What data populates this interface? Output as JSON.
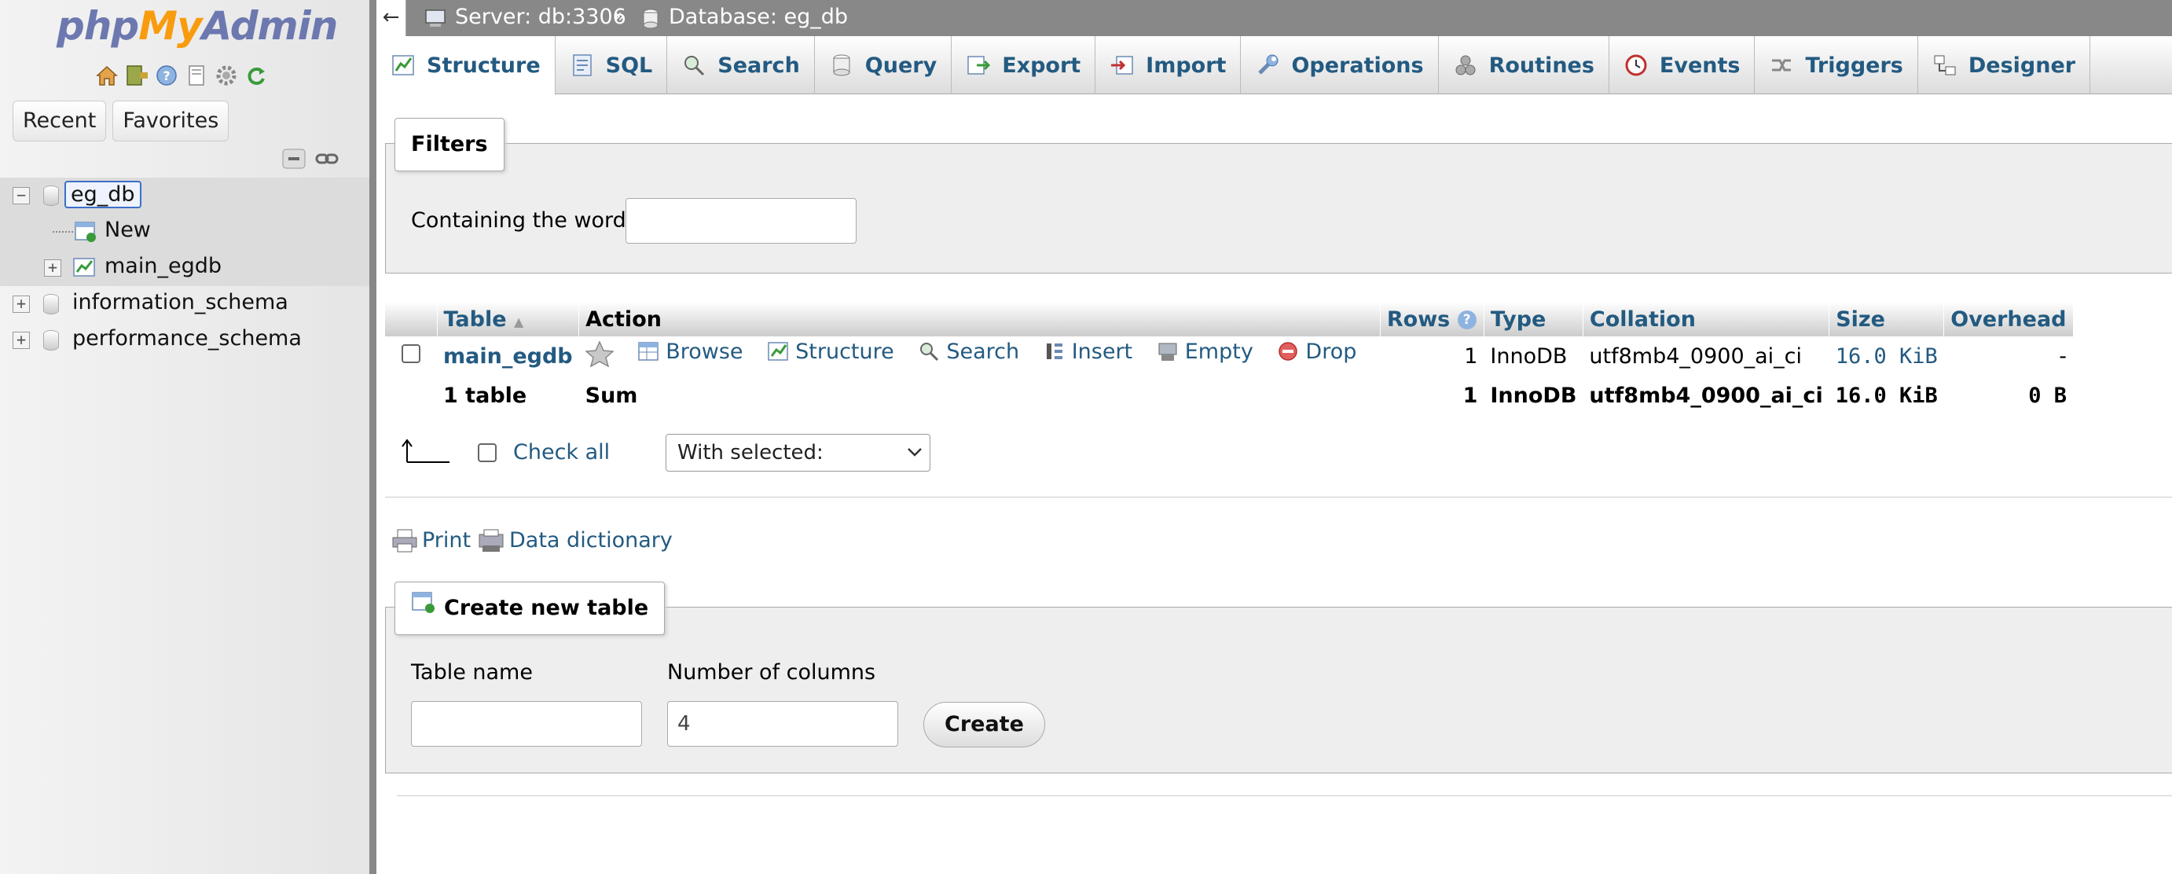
{
  "nav": {
    "logo": {
      "php": "php",
      "my": "My",
      "admin": "Admin"
    },
    "icons": [
      "home-icon",
      "exit-icon",
      "help-icon",
      "docs-icon",
      "settings-icon",
      "reload-icon"
    ],
    "tabs": {
      "recent": "Recent",
      "favorites": "Favorites"
    },
    "tree": {
      "db_selected": "eg_db",
      "new_label": "New",
      "table_main": "main_egdb",
      "db_info": "information_schema",
      "db_perf": "performance_schema"
    }
  },
  "topbar": {
    "back": "←",
    "server": "Server: db:3306",
    "separator": "»",
    "database": "Database: eg_db"
  },
  "tabs": [
    {
      "label": "Structure",
      "icon": "structure-icon",
      "active": true
    },
    {
      "label": "SQL",
      "icon": "sql-icon"
    },
    {
      "label": "Search",
      "icon": "search-icon"
    },
    {
      "label": "Query",
      "icon": "query-icon"
    },
    {
      "label": "Export",
      "icon": "export-icon"
    },
    {
      "label": "Import",
      "icon": "import-icon"
    },
    {
      "label": "Operations",
      "icon": "wrench-icon"
    },
    {
      "label": "Routines",
      "icon": "routines-icon"
    },
    {
      "label": "Events",
      "icon": "clock-icon"
    },
    {
      "label": "Triggers",
      "icon": "triggers-icon"
    },
    {
      "label": "Designer",
      "icon": "designer-icon"
    }
  ],
  "filters": {
    "legend": "Filters",
    "label": "Containing the word:",
    "value": ""
  },
  "table": {
    "headers": {
      "table": "Table",
      "action": "Action",
      "rows": "Rows",
      "type": "Type",
      "collation": "Collation",
      "size": "Size",
      "overhead": "Overhead"
    },
    "row": {
      "name": "main_egdb",
      "actions": {
        "browse": "Browse",
        "structure": "Structure",
        "search": "Search",
        "insert": "Insert",
        "empty": "Empty",
        "drop": "Drop"
      },
      "rows": "1",
      "type": "InnoDB",
      "collation": "utf8mb4_0900_ai_ci",
      "size": "16.0 KiB",
      "overhead": "-"
    },
    "sum": {
      "label": "1 table",
      "action": "Sum",
      "rows": "1",
      "type": "InnoDB",
      "collation": "utf8mb4_0900_ai_ci",
      "size": "16.0 KiB",
      "overhead": "0 B"
    }
  },
  "bulk": {
    "check_all": "Check all",
    "with_selected": "With selected:"
  },
  "links": {
    "print": "Print",
    "data_dictionary": "Data dictionary"
  },
  "create": {
    "legend": "Create new table",
    "table_name_label": "Table name",
    "table_name_value": "",
    "columns_label": "Number of columns",
    "columns_value": "4",
    "button": "Create"
  }
}
